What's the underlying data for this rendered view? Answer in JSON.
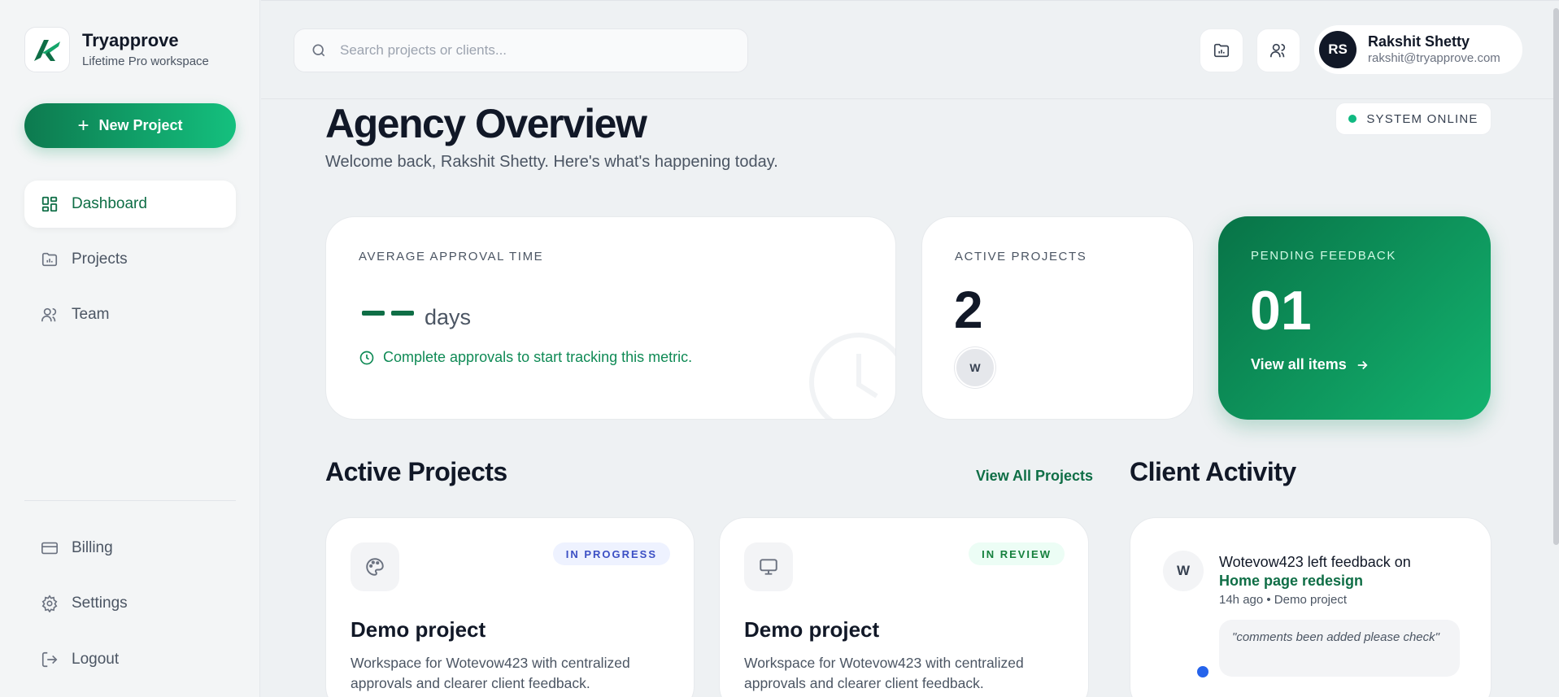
{
  "brand": {
    "name": "Tryapprove",
    "sub": "Lifetime Pro workspace"
  },
  "sidebar": {
    "new_project": "New Project",
    "items": [
      {
        "label": "Dashboard",
        "icon": "dashboard-icon",
        "active": true
      },
      {
        "label": "Projects",
        "icon": "folder-chart-icon"
      },
      {
        "label": "Team",
        "icon": "users-icon"
      }
    ],
    "bottom": [
      {
        "label": "Billing",
        "icon": "credit-card-icon"
      },
      {
        "label": "Settings",
        "icon": "gear-icon"
      },
      {
        "label": "Logout",
        "icon": "logout-icon"
      }
    ]
  },
  "header": {
    "search_placeholder": "Search projects or clients...",
    "user": {
      "initials": "RS",
      "name": "Rakshit Shetty",
      "email": "rakshit@tryapprove.com"
    }
  },
  "main": {
    "title": "Agency Overview",
    "subtitle": "Welcome back, Rakshit Shetty. Here's what's happening today.",
    "status": "SYSTEM ONLINE",
    "stats": {
      "avg": {
        "label": "AVERAGE APPROVAL TIME",
        "unit": "days",
        "hint": "Complete approvals to start tracking this metric."
      },
      "active": {
        "label": "ACTIVE PROJECTS",
        "value": "2",
        "avatar": "W"
      },
      "pending": {
        "label": "PENDING FEEDBACK",
        "value": "01",
        "link": "View all items"
      }
    },
    "projects_title": "Active Projects",
    "view_all": "View All Projects",
    "projects": [
      {
        "status": "IN PROGRESS",
        "name": "Demo project",
        "desc": "Workspace for Wotevow423 with centralized approvals and clearer client feedback.",
        "icon": "palette-icon"
      },
      {
        "status": "IN REVIEW",
        "name": "Demo project",
        "desc": "Workspace for Wotevow423 with centralized approvals and clearer client feedback.",
        "icon": "monitor-icon"
      }
    ],
    "activity_title": "Client Activity",
    "activity": {
      "avatar": "W",
      "text": "Wotevow423 left feedback on",
      "link": "Home page redesign",
      "meta": "14h ago • Demo project",
      "quote": "\"comments been added please check\""
    }
  },
  "colors": {
    "accent": "#0f6e46",
    "accent_light": "#14c07e",
    "status_online": "#10b981"
  }
}
